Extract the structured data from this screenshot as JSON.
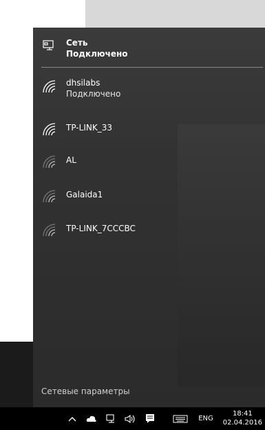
{
  "network_flyout": {
    "wired": {
      "name": "Сеть",
      "status": "Подключено",
      "icon": "ethernet-icon"
    },
    "wifi_networks": [
      {
        "ssid": "dhsilabs",
        "status": "Подключено",
        "icon": "wifi-icon"
      },
      {
        "ssid": "TP-LINK_33",
        "status": "",
        "icon": "wifi-icon"
      },
      {
        "ssid": "AL",
        "status": "",
        "icon": "wifi-icon"
      },
      {
        "ssid": "Galaida1",
        "status": "",
        "icon": "wifi-icon"
      },
      {
        "ssid": "TP-LINK_7CCCBC",
        "status": "",
        "icon": "wifi-icon"
      }
    ],
    "settings_link": "Сетевые параметры"
  },
  "taskbar": {
    "tray_icons": [
      "chevron-up-icon",
      "cloud-icon",
      "network-icon",
      "speaker-icon",
      "action-center-icon",
      "keyboard-icon"
    ],
    "language": "ENG",
    "time": "18:41",
    "date": "02.04.2016"
  }
}
